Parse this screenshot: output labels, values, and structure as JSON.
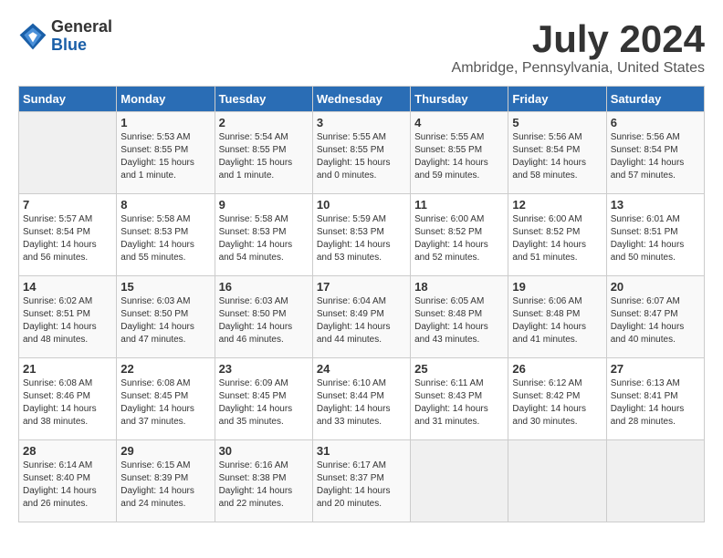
{
  "logo": {
    "general": "General",
    "blue": "Blue"
  },
  "title": "July 2024",
  "subtitle": "Ambridge, Pennsylvania, United States",
  "days_of_week": [
    "Sunday",
    "Monday",
    "Tuesday",
    "Wednesday",
    "Thursday",
    "Friday",
    "Saturday"
  ],
  "weeks": [
    [
      {
        "day": "",
        "info": ""
      },
      {
        "day": "1",
        "info": "Sunrise: 5:53 AM\nSunset: 8:55 PM\nDaylight: 15 hours\nand 1 minute."
      },
      {
        "day": "2",
        "info": "Sunrise: 5:54 AM\nSunset: 8:55 PM\nDaylight: 15 hours\nand 1 minute."
      },
      {
        "day": "3",
        "info": "Sunrise: 5:55 AM\nSunset: 8:55 PM\nDaylight: 15 hours\nand 0 minutes."
      },
      {
        "day": "4",
        "info": "Sunrise: 5:55 AM\nSunset: 8:55 PM\nDaylight: 14 hours\nand 59 minutes."
      },
      {
        "day": "5",
        "info": "Sunrise: 5:56 AM\nSunset: 8:54 PM\nDaylight: 14 hours\nand 58 minutes."
      },
      {
        "day": "6",
        "info": "Sunrise: 5:56 AM\nSunset: 8:54 PM\nDaylight: 14 hours\nand 57 minutes."
      }
    ],
    [
      {
        "day": "7",
        "info": "Sunrise: 5:57 AM\nSunset: 8:54 PM\nDaylight: 14 hours\nand 56 minutes."
      },
      {
        "day": "8",
        "info": "Sunrise: 5:58 AM\nSunset: 8:53 PM\nDaylight: 14 hours\nand 55 minutes."
      },
      {
        "day": "9",
        "info": "Sunrise: 5:58 AM\nSunset: 8:53 PM\nDaylight: 14 hours\nand 54 minutes."
      },
      {
        "day": "10",
        "info": "Sunrise: 5:59 AM\nSunset: 8:53 PM\nDaylight: 14 hours\nand 53 minutes."
      },
      {
        "day": "11",
        "info": "Sunrise: 6:00 AM\nSunset: 8:52 PM\nDaylight: 14 hours\nand 52 minutes."
      },
      {
        "day": "12",
        "info": "Sunrise: 6:00 AM\nSunset: 8:52 PM\nDaylight: 14 hours\nand 51 minutes."
      },
      {
        "day": "13",
        "info": "Sunrise: 6:01 AM\nSunset: 8:51 PM\nDaylight: 14 hours\nand 50 minutes."
      }
    ],
    [
      {
        "day": "14",
        "info": "Sunrise: 6:02 AM\nSunset: 8:51 PM\nDaylight: 14 hours\nand 48 minutes."
      },
      {
        "day": "15",
        "info": "Sunrise: 6:03 AM\nSunset: 8:50 PM\nDaylight: 14 hours\nand 47 minutes."
      },
      {
        "day": "16",
        "info": "Sunrise: 6:03 AM\nSunset: 8:50 PM\nDaylight: 14 hours\nand 46 minutes."
      },
      {
        "day": "17",
        "info": "Sunrise: 6:04 AM\nSunset: 8:49 PM\nDaylight: 14 hours\nand 44 minutes."
      },
      {
        "day": "18",
        "info": "Sunrise: 6:05 AM\nSunset: 8:48 PM\nDaylight: 14 hours\nand 43 minutes."
      },
      {
        "day": "19",
        "info": "Sunrise: 6:06 AM\nSunset: 8:48 PM\nDaylight: 14 hours\nand 41 minutes."
      },
      {
        "day": "20",
        "info": "Sunrise: 6:07 AM\nSunset: 8:47 PM\nDaylight: 14 hours\nand 40 minutes."
      }
    ],
    [
      {
        "day": "21",
        "info": "Sunrise: 6:08 AM\nSunset: 8:46 PM\nDaylight: 14 hours\nand 38 minutes."
      },
      {
        "day": "22",
        "info": "Sunrise: 6:08 AM\nSunset: 8:45 PM\nDaylight: 14 hours\nand 37 minutes."
      },
      {
        "day": "23",
        "info": "Sunrise: 6:09 AM\nSunset: 8:45 PM\nDaylight: 14 hours\nand 35 minutes."
      },
      {
        "day": "24",
        "info": "Sunrise: 6:10 AM\nSunset: 8:44 PM\nDaylight: 14 hours\nand 33 minutes."
      },
      {
        "day": "25",
        "info": "Sunrise: 6:11 AM\nSunset: 8:43 PM\nDaylight: 14 hours\nand 31 minutes."
      },
      {
        "day": "26",
        "info": "Sunrise: 6:12 AM\nSunset: 8:42 PM\nDaylight: 14 hours\nand 30 minutes."
      },
      {
        "day": "27",
        "info": "Sunrise: 6:13 AM\nSunset: 8:41 PM\nDaylight: 14 hours\nand 28 minutes."
      }
    ],
    [
      {
        "day": "28",
        "info": "Sunrise: 6:14 AM\nSunset: 8:40 PM\nDaylight: 14 hours\nand 26 minutes."
      },
      {
        "day": "29",
        "info": "Sunrise: 6:15 AM\nSunset: 8:39 PM\nDaylight: 14 hours\nand 24 minutes."
      },
      {
        "day": "30",
        "info": "Sunrise: 6:16 AM\nSunset: 8:38 PM\nDaylight: 14 hours\nand 22 minutes."
      },
      {
        "day": "31",
        "info": "Sunrise: 6:17 AM\nSunset: 8:37 PM\nDaylight: 14 hours\nand 20 minutes."
      },
      {
        "day": "",
        "info": ""
      },
      {
        "day": "",
        "info": ""
      },
      {
        "day": "",
        "info": ""
      }
    ]
  ]
}
